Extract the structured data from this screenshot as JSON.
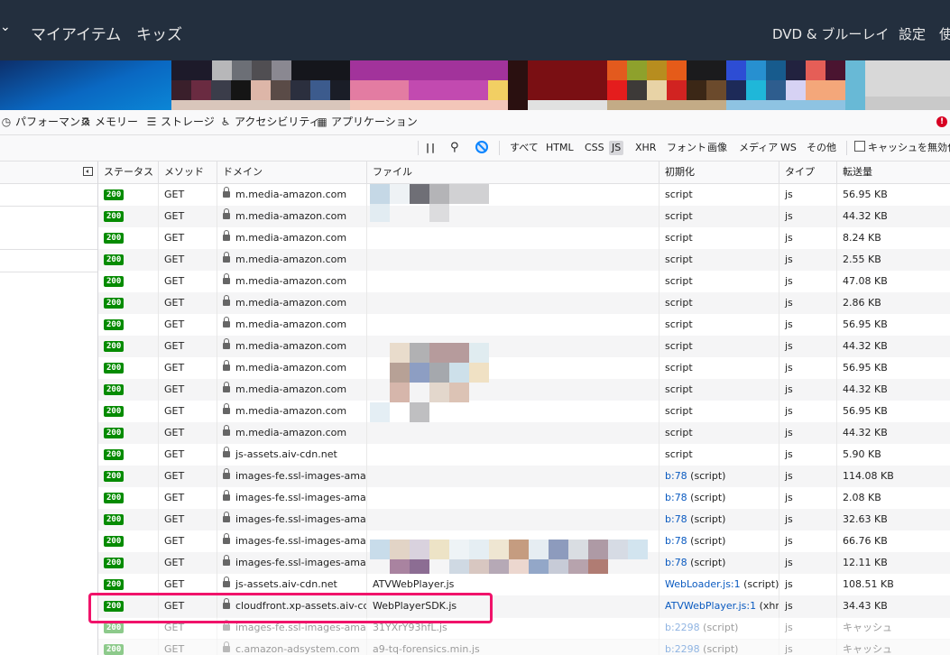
{
  "amazon_nav": {
    "left_items": [
      "マイアイテム",
      "キッズ"
    ],
    "right_items": [
      "DVD & ブルーレイ",
      "設定",
      "使"
    ]
  },
  "devtools_tools": [
    {
      "label": "パフォーマンス",
      "icon": "performance-icon"
    },
    {
      "label": "メモリー",
      "icon": "memory-icon"
    },
    {
      "label": "ストレージ",
      "icon": "storage-icon"
    },
    {
      "label": "アクセシビリティ",
      "icon": "accessibility-icon"
    },
    {
      "label": "アプリケーション",
      "icon": "application-icon"
    }
  ],
  "filters": {
    "types": [
      "すべて",
      "HTML",
      "CSS",
      "JS",
      "XHR",
      "フォント",
      "画像",
      "メディア",
      "WS",
      "その他"
    ],
    "active": "JS",
    "disable_cache_label": "キャッシュを無効化"
  },
  "columns": [
    "ステータス",
    "メソッド",
    "ドメイン",
    "ファイル",
    "初期化",
    "タイプ",
    "転送量"
  ],
  "rows": [
    {
      "status": "200",
      "method": "GET",
      "domain": "m.media-amazon.com",
      "file": "",
      "init": "script",
      "type": "js",
      "size": "56.95 KB"
    },
    {
      "status": "200",
      "method": "GET",
      "domain": "m.media-amazon.com",
      "file": "",
      "init": "script",
      "type": "js",
      "size": "44.32 KB"
    },
    {
      "status": "200",
      "method": "GET",
      "domain": "m.media-amazon.com",
      "file": "",
      "init": "script",
      "type": "js",
      "size": "8.24 KB"
    },
    {
      "status": "200",
      "method": "GET",
      "domain": "m.media-amazon.com",
      "file": "",
      "init": "script",
      "type": "js",
      "size": "2.55 KB"
    },
    {
      "status": "200",
      "method": "GET",
      "domain": "m.media-amazon.com",
      "file": "",
      "init": "script",
      "type": "js",
      "size": "47.08 KB"
    },
    {
      "status": "200",
      "method": "GET",
      "domain": "m.media-amazon.com",
      "file": "",
      "init": "script",
      "type": "js",
      "size": "2.86 KB"
    },
    {
      "status": "200",
      "method": "GET",
      "domain": "m.media-amazon.com",
      "file": "",
      "init": "script",
      "type": "js",
      "size": "56.95 KB"
    },
    {
      "status": "200",
      "method": "GET",
      "domain": "m.media-amazon.com",
      "file": "",
      "init": "script",
      "type": "js",
      "size": "44.32 KB"
    },
    {
      "status": "200",
      "method": "GET",
      "domain": "m.media-amazon.com",
      "file": "",
      "init": "script",
      "type": "js",
      "size": "56.95 KB"
    },
    {
      "status": "200",
      "method": "GET",
      "domain": "m.media-amazon.com",
      "file": "",
      "init": "script",
      "type": "js",
      "size": "44.32 KB"
    },
    {
      "status": "200",
      "method": "GET",
      "domain": "m.media-amazon.com",
      "file": "",
      "init": "script",
      "type": "js",
      "size": "56.95 KB"
    },
    {
      "status": "200",
      "method": "GET",
      "domain": "m.media-amazon.com",
      "file": "",
      "init": "script",
      "type": "js",
      "size": "44.32 KB"
    },
    {
      "status": "200",
      "method": "GET",
      "domain": "js-assets.aiv-cdn.net",
      "file": "",
      "init": "script",
      "type": "js",
      "size": "5.90 KB"
    },
    {
      "status": "200",
      "method": "GET",
      "domain": "images-fe.ssl-images-amaz...",
      "file": "",
      "init_link": "b:78",
      "init_suffix": " (script)",
      "type": "js",
      "size": "114.08 KB"
    },
    {
      "status": "200",
      "method": "GET",
      "domain": "images-fe.ssl-images-amaz...",
      "file": "",
      "init_link": "b:78",
      "init_suffix": " (script)",
      "type": "js",
      "size": "2.08 KB"
    },
    {
      "status": "200",
      "method": "GET",
      "domain": "images-fe.ssl-images-amaz...",
      "file": "",
      "init_link": "b:78",
      "init_suffix": " (script)",
      "type": "js",
      "size": "32.63 KB"
    },
    {
      "status": "200",
      "method": "GET",
      "domain": "images-fe.ssl-images-amaz...",
      "file": "",
      "init_link": "b:78",
      "init_suffix": " (script)",
      "type": "js",
      "size": "66.76 KB"
    },
    {
      "status": "200",
      "method": "GET",
      "domain": "images-fe.ssl-images-amaz...",
      "file": "",
      "init_link": "b:78",
      "init_suffix": " (script)",
      "type": "js",
      "size": "12.11 KB"
    },
    {
      "status": "200",
      "method": "GET",
      "domain": "js-assets.aiv-cdn.net",
      "file": "ATVWebPlayer.js",
      "init_link": "WebLoader.js:1",
      "init_suffix": " (script)",
      "type": "js",
      "size": "108.51 KB"
    },
    {
      "status": "200",
      "method": "GET",
      "domain": "cloudfront.xp-assets.aiv-cd...",
      "file": "WebPlayerSDK.js",
      "init_link": "ATVWebPlayer.js:1",
      "init_suffix": " (xhr)",
      "type": "js",
      "size": "34.43 KB"
    },
    {
      "status": "200",
      "method": "GET",
      "domain": "images-fe.ssl-images-amaz...",
      "file": "31YXrY93hfL.js",
      "init_link": "b:2298",
      "init_suffix": " (script)",
      "type": "js",
      "size": "キャッシュ"
    },
    {
      "status": "200",
      "method": "GET",
      "domain": "c.amazon-adsystem.com",
      "file": "a9-tq-forensics.min.js",
      "init_link": "b:2298",
      "init_suffix": " (script)",
      "type": "js",
      "size": "キャッシュ"
    }
  ],
  "colors": {
    "nav_bg": "#232f3e",
    "status_ok": "#058b00",
    "link": "#0a5ac0",
    "highlight": "#f0136a"
  }
}
